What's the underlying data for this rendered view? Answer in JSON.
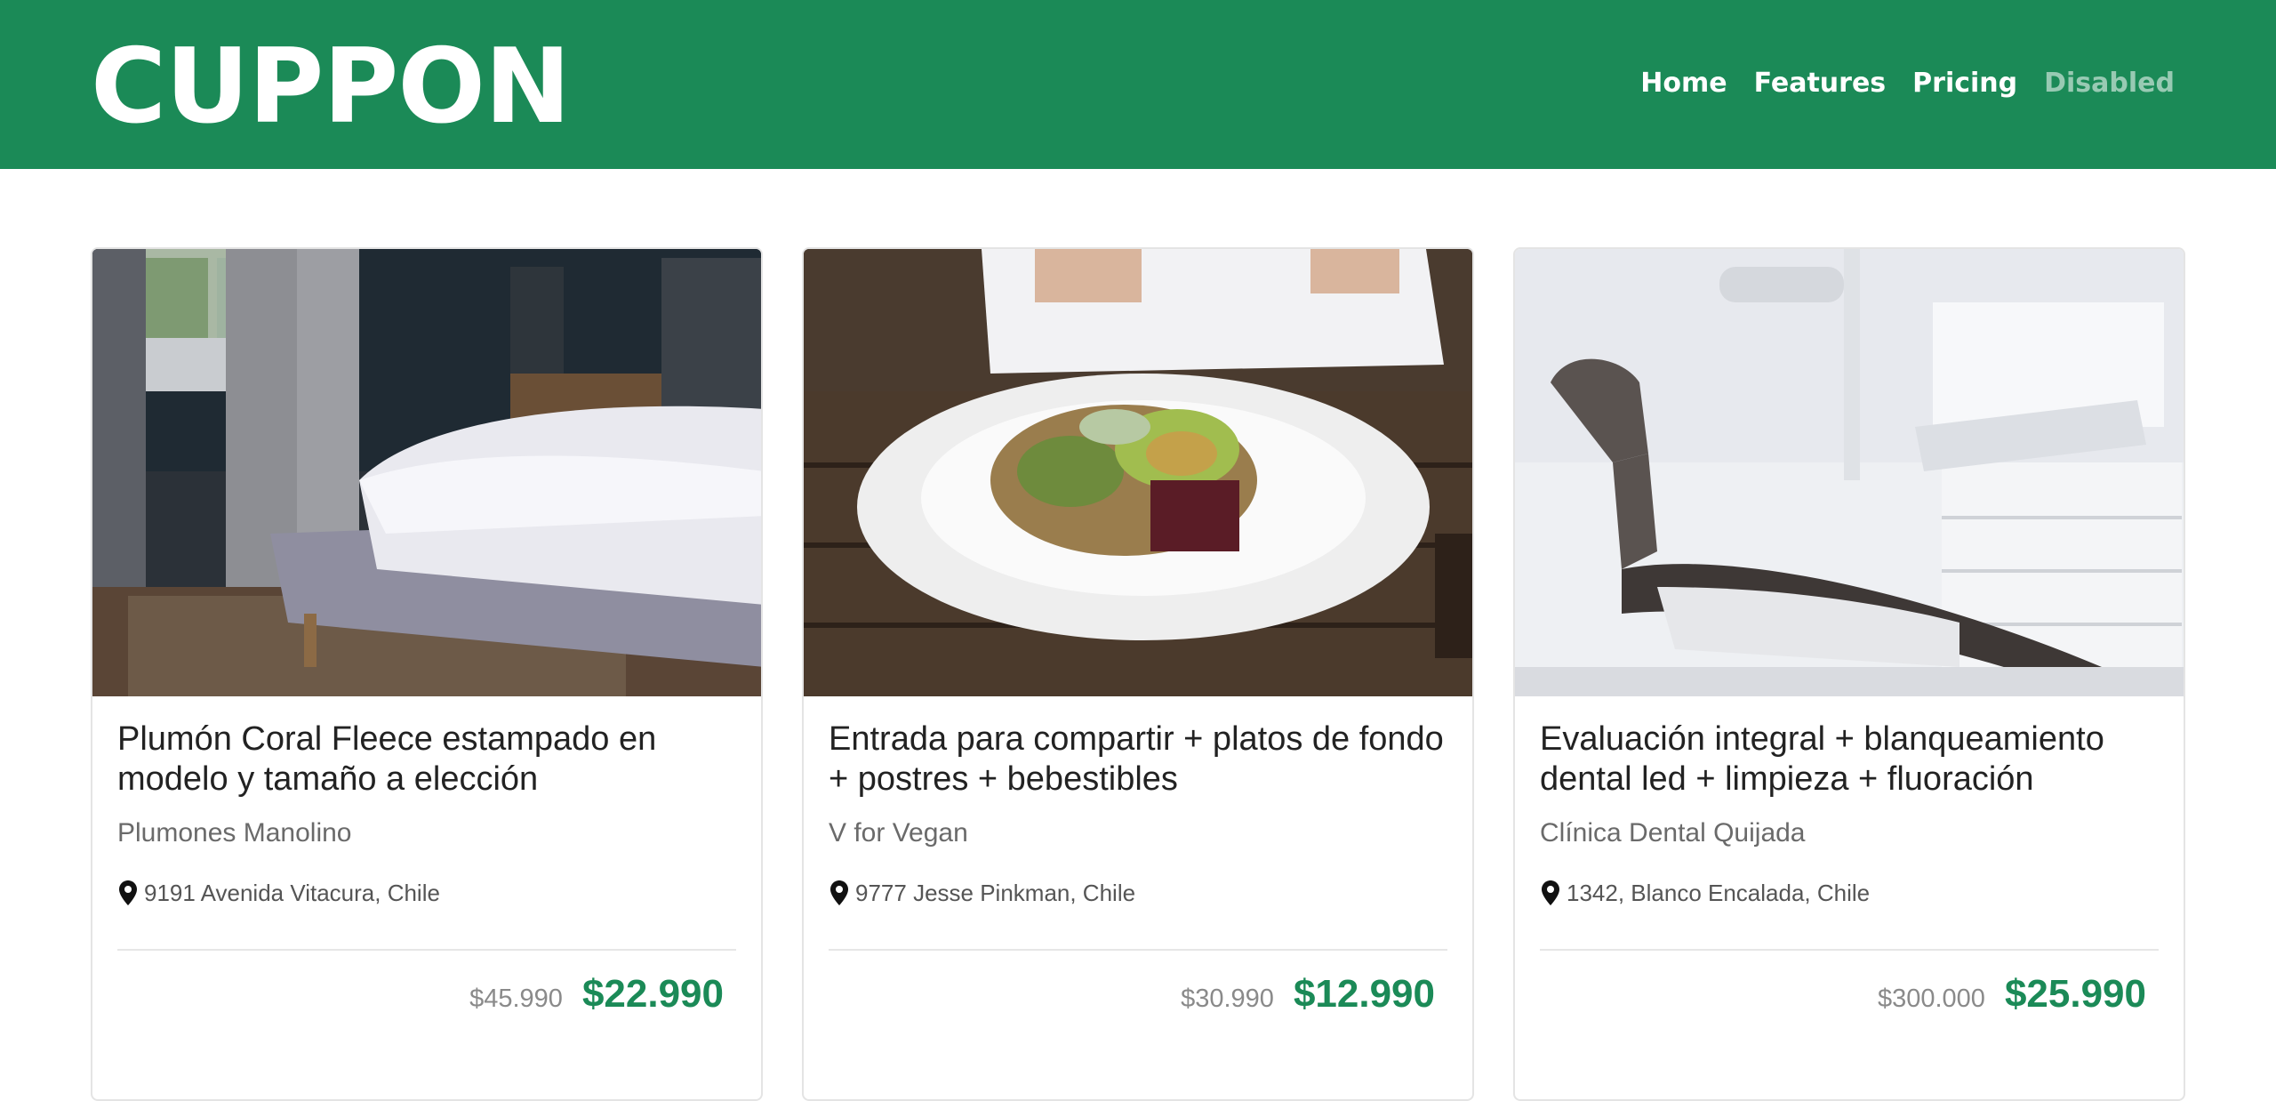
{
  "brand": "CUPPON",
  "nav": {
    "home": "Home",
    "features": "Features",
    "pricing": "Pricing",
    "disabled": "Disabled"
  },
  "cards": [
    {
      "title": "Plumón Coral Fleece estampado en modelo y tamaño a elección",
      "vendor": "Plumones Manolino",
      "location": "9191 Avenida Vitacura, Chile",
      "old_price": "$45.990",
      "new_price": "$22.990",
      "image": "bed-photo"
    },
    {
      "title": "Entrada para compartir + platos de fondo + postres + bebestibles",
      "vendor": "V for Vegan",
      "location": "9777 Jesse Pinkman, Chile",
      "old_price": "$30.990",
      "new_price": "$12.990",
      "image": "salad-photo"
    },
    {
      "title": "Evaluación integral + blanqueamiento dental led + limpieza + fluoración",
      "vendor": "Clínica Dental Quijada",
      "location": "1342, Blanco Encalada, Chile",
      "old_price": "$300.000",
      "new_price": "$25.990",
      "image": "dental-chair-photo"
    }
  ],
  "colors": {
    "primary": "#1b8a57",
    "text": "#222222",
    "muted": "#6a6a6a"
  }
}
